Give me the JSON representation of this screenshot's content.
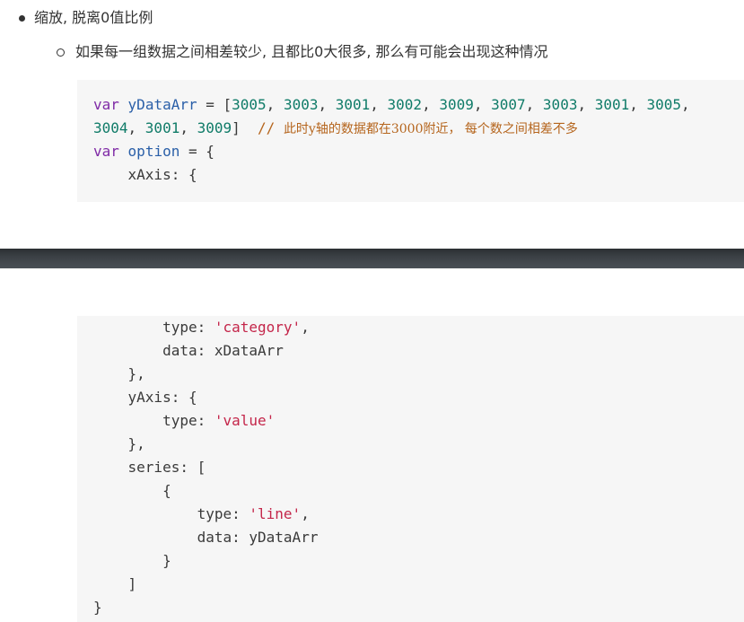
{
  "list": {
    "item1": "缩放, 脱离0值比例",
    "item2": "如果每一组数据之间相差较少, 且都比0大很多, 那么有可能会出现这种情况"
  },
  "code_top": {
    "l1_kw": "var",
    "l1_id": "yDataArr",
    "l1_op": " = [",
    "l1_n1": "3005",
    "l1_n2": "3003",
    "l1_n3": "3001",
    "l1_n4": "3002",
    "l1_n5": "3009",
    "l1_n6": "3007",
    "l1_n7": "3003",
    "l1_n8": "3001",
    "l1_n9": "3005",
    "sep": ", ",
    "l2_n1": "3004",
    "l2_n2": "3001",
    "l2_n3": "3009",
    "l2_close": "]  ",
    "l2_comment_slash": "// ",
    "l2_comment": "此时y轴的数据都在3000附近， 每个数之间相差不多",
    "l3_kw": "var",
    "l3_id": "option",
    "l3_rest": " = {",
    "l4": "    xAxis: {"
  },
  "code_bottom": {
    "l1_key": "        type: ",
    "l1_str": "'category'",
    "l1_end": ",",
    "l2": "        data: xDataArr",
    "l3": "    },",
    "l4": "    yAxis: {",
    "l5_key": "        type: ",
    "l5_str": "'value'",
    "l6": "    },",
    "l7": "    series: [",
    "l8": "        {",
    "l9_key": "            type: ",
    "l9_str": "'line'",
    "l9_end": ",",
    "l10": "            data: yDataArr",
    "l11": "        }",
    "l12": "    ]",
    "l13": "}"
  }
}
